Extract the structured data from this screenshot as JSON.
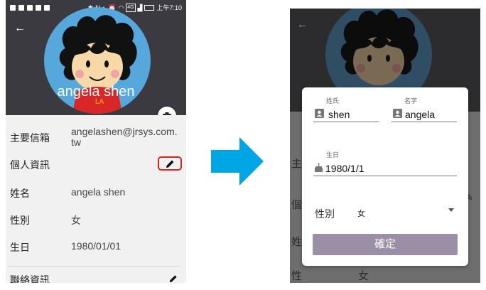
{
  "left": {
    "status_time": "上午7:10",
    "status_net": "4G",
    "profile_name": "angela shen",
    "rows": [
      {
        "label": "主要信箱",
        "value": "angelashen@jrsys.com.tw"
      },
      {
        "label": "個人資訊",
        "value": ""
      },
      {
        "label": "姓名",
        "value": "angela shen"
      },
      {
        "label": "性別",
        "value": "女"
      },
      {
        "label": "生日",
        "value": "1980/01/01"
      },
      {
        "label": "聯絡資訊",
        "value": ""
      }
    ]
  },
  "dialog": {
    "last_name_caption": "姓氏",
    "last_name_value": "shen",
    "first_name_caption": "名字",
    "first_name_value": "angela",
    "birthday_caption": "生日",
    "birthday_value": "1980/1/1",
    "gender_label": "性別",
    "gender_value": "女",
    "confirm_label": "確定"
  },
  "colors": {
    "highlight": "#e02020",
    "arrow": "#00a6e4",
    "confirm": "#9b8fa6"
  },
  "icons": [
    "back-arrow-icon",
    "camera-icon",
    "pencil-icon",
    "person-icon",
    "cake-icon",
    "dropdown-arrow-icon"
  ]
}
